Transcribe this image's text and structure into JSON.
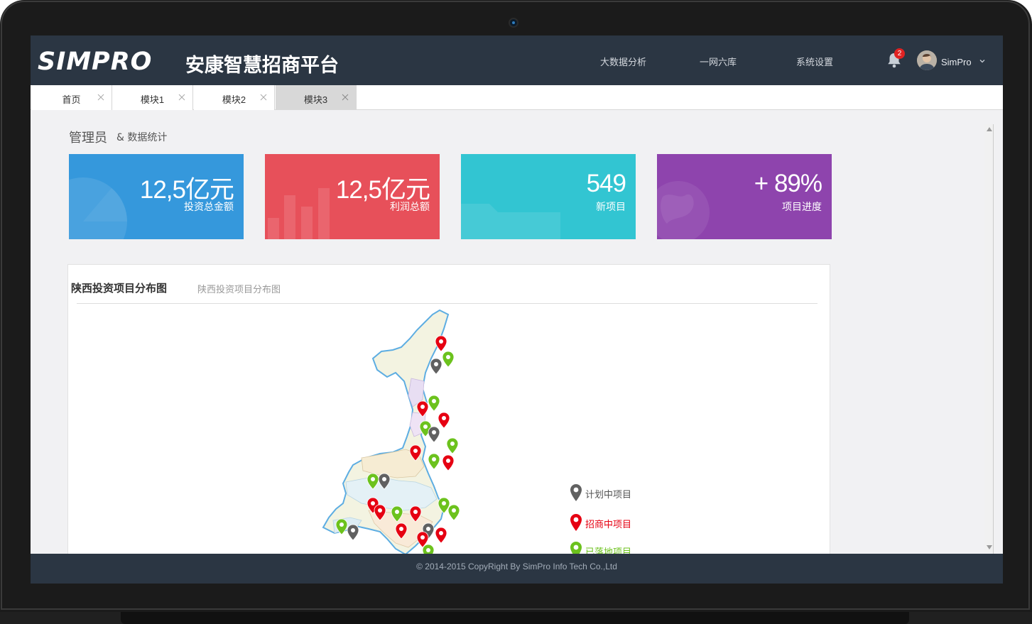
{
  "header": {
    "logo_text": "SIMPRO",
    "app_title": "安康智慧招商平台",
    "nav": [
      "大数据分析",
      "一网六库",
      "系统设置"
    ],
    "notification_count": "2",
    "user_name": "SimPro"
  },
  "tabs": [
    {
      "label": "首页",
      "active": false
    },
    {
      "label": "模块1",
      "active": false
    },
    {
      "label": "模块2",
      "active": false
    },
    {
      "label": "模块3",
      "active": true
    }
  ],
  "page": {
    "heading": "管理员",
    "subheading": "& 数据统计"
  },
  "stats": [
    {
      "value": "12,5亿元",
      "label": "投资总金额",
      "color": "#3598dc",
      "icon": "pie-chart-icon"
    },
    {
      "value": "12,5亿元",
      "label": "利润总额",
      "color": "#e7505a",
      "icon": "bar-chart-icon"
    },
    {
      "value": "549",
      "label": "新项目",
      "color": "#32c5d2",
      "icon": "folder-icon"
    },
    {
      "value": "+ 89%",
      "label": "项目进度",
      "color": "#8e44ad",
      "icon": "globe-icon"
    }
  ],
  "map_panel": {
    "title": "陕西投资项目分布图",
    "subtitle": "陕西投资项目分布图",
    "legend": [
      {
        "label": "计划中项目",
        "color": "#616161"
      },
      {
        "label": "招商中项目",
        "color": "#e60012"
      },
      {
        "label": "已落地项目",
        "color": "#6cc21d"
      }
    ]
  },
  "footer": {
    "copyright": "© 2014-2015 CopyRight By SimPro Info Tech Co.,Ltd"
  }
}
